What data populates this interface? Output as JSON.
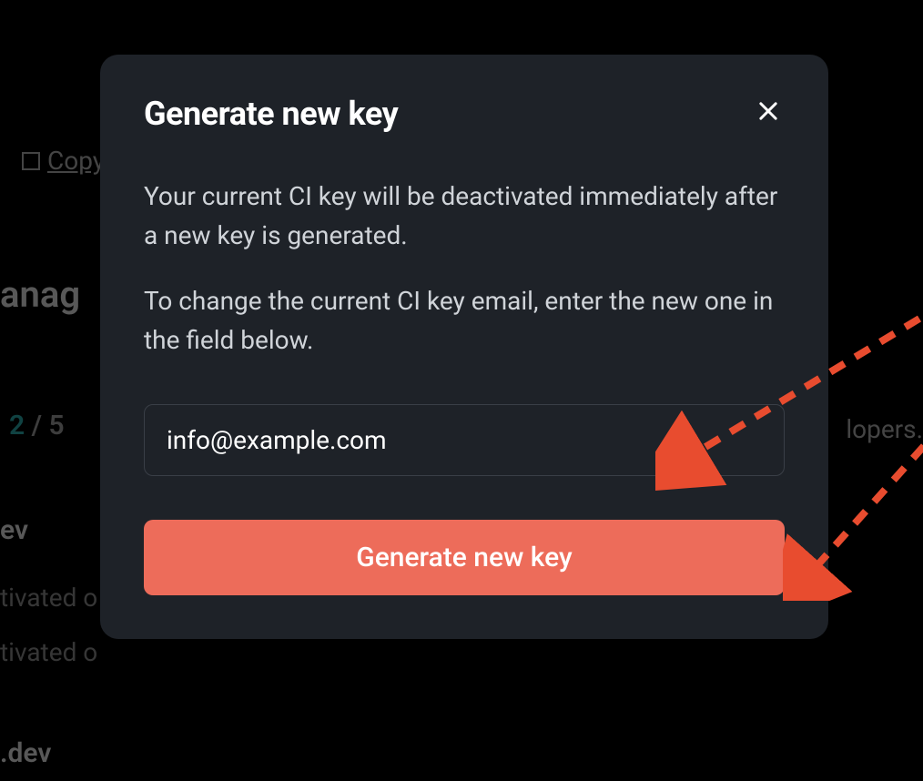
{
  "background": {
    "copy_label": "Copy",
    "anag_text": "anag",
    "count_current": "2",
    "count_separator": " / ",
    "count_total": "5",
    "dev_label": "ev",
    "tivated_text": "tivated o",
    "dev2_label": ".dev",
    "lopers_text": "lopers."
  },
  "modal": {
    "title": "Generate new key",
    "paragraph1": "Your current CI key will be deactivated immediately after a new key is generated.",
    "paragraph2": "To change the current CI key email, enter the new one in the field below.",
    "email_value": "info@example.com",
    "button_label": "Generate new key"
  }
}
